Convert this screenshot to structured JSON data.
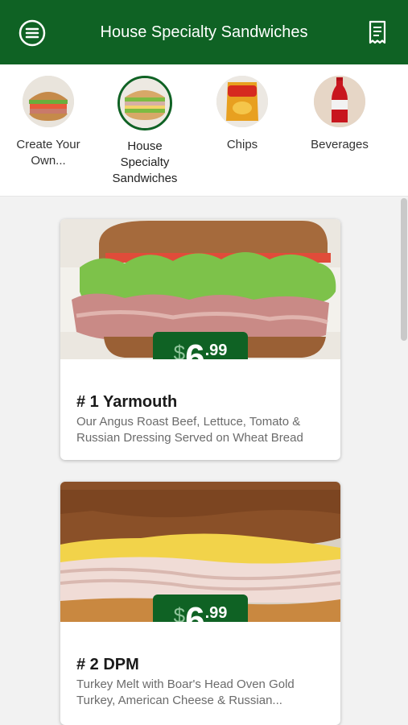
{
  "header": {
    "title": "House Specialty Sandwiches",
    "menu_icon": "hamburger-menu-icon",
    "receipt_icon": "receipt-icon",
    "color": "#0f6224"
  },
  "categories": [
    {
      "label": "Create Your Own...",
      "icon": "sandwich-thumbnail",
      "active": false
    },
    {
      "label": "House Specialty Sandwiches",
      "icon": "club-sandwich-thumbnail",
      "active": true
    },
    {
      "label": "Chips",
      "icon": "fritos-bag-thumbnail",
      "active": false
    },
    {
      "label": "Beverages",
      "icon": "cola-bottle-thumbnail",
      "active": false
    }
  ],
  "items": [
    {
      "name": "# 1 Yarmouth",
      "description": "Our Angus Roast Beef, Lettuce, Tomato & Russian Dressing Served on Wheat Bread",
      "price": {
        "currency": "$",
        "whole": "6",
        "cents": ".99"
      }
    },
    {
      "name": "# 2 DPM",
      "description": "Turkey Melt with Boar's Head Oven Gold Turkey, American Cheese & Russian...",
      "price": {
        "currency": "$",
        "whole": "6",
        "cents": ".99"
      }
    }
  ]
}
